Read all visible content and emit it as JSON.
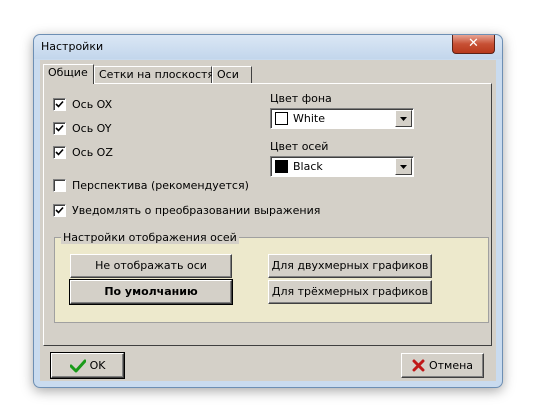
{
  "window": {
    "title": "Настройки",
    "close_glyph": "✕"
  },
  "tabs": [
    {
      "label": "Общие",
      "active": true
    },
    {
      "label": "Сетки на плоскостях",
      "active": false
    },
    {
      "label": "Оси",
      "active": false
    }
  ],
  "general": {
    "checkboxes": [
      {
        "label": "Ось OX",
        "checked": true
      },
      {
        "label": "Ось OY",
        "checked": true
      },
      {
        "label": "Ось OZ",
        "checked": true
      },
      {
        "label": "Перспектива (рекомендуется)",
        "checked": false
      },
      {
        "label": "Уведомлять о преобразовании выражения",
        "checked": true
      }
    ],
    "background_color": {
      "label": "Цвет фона",
      "value": "White",
      "swatch": "#ffffff"
    },
    "axis_color": {
      "label": "Цвет осей",
      "value": "Black",
      "swatch": "#000000"
    },
    "axis_display": {
      "title": "Настройки отображения осей",
      "buttons": {
        "hide_axes": "Не отображать оси",
        "default": "По умолчанию",
        "two_d": "Для двухмерных графиков",
        "three_d": "Для трёхмерных графиков"
      }
    }
  },
  "footer": {
    "ok_label": "OK",
    "cancel_label": "Отмена"
  }
}
